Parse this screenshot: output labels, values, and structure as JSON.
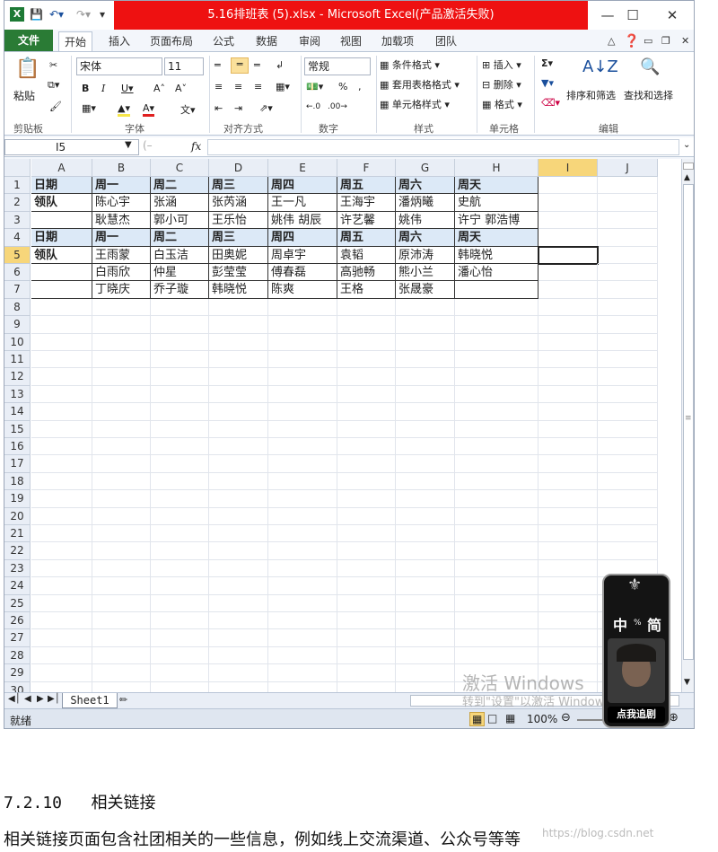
{
  "title": "5.16排班表 (5).xlsx - Microsoft Excel(产品激活失败)",
  "ribbon_tabs": [
    "文件",
    "开始",
    "插入",
    "页面布局",
    "公式",
    "数据",
    "审阅",
    "视图",
    "加载项",
    "团队"
  ],
  "ribbon": {
    "paste": "粘贴",
    "font_name": "宋体",
    "font_size": "11",
    "number_format": "常规",
    "conditional_format": "条件格式",
    "table_format": "套用表格格式",
    "cell_style": "单元格样式",
    "insert": "插入",
    "delete": "删除",
    "format": "格式",
    "sort_filter": "排序和筛选",
    "find_select": "查找和选择",
    "groups": [
      "剪贴板",
      "字体",
      "对齐方式",
      "数字",
      "样式",
      "单元格",
      "编辑"
    ]
  },
  "namebox": "I5",
  "formula_fx": "fx",
  "columns": [
    "A",
    "B",
    "C",
    "D",
    "E",
    "F",
    "G",
    "H",
    "I",
    "J"
  ],
  "rows": [
    "1",
    "2",
    "3",
    "4",
    "5",
    "6",
    "7",
    "8",
    "9",
    "10",
    "11",
    "12",
    "13",
    "14",
    "15",
    "16",
    "17",
    "18",
    "19",
    "20",
    "21",
    "22",
    "23",
    "24",
    "25",
    "26",
    "27",
    "28",
    "29",
    "30"
  ],
  "cells": {
    "r1": [
      "日期",
      "周一",
      "周二",
      "周三",
      "周四",
      "周五",
      "周六",
      "周天"
    ],
    "r2": [
      "领队",
      "陈心宇",
      "张涵",
      "张芮涵",
      "王一凡",
      "王海宇",
      "潘炳曦",
      "史航"
    ],
    "r3": [
      "",
      "耿慧杰",
      "郭小可",
      "王乐怡",
      "姚伟 胡辰",
      "许艺馨",
      "姚伟",
      "许宁 郭浩博"
    ],
    "r4": [
      "日期",
      "周一",
      "周二",
      "周三",
      "周四",
      "周五",
      "周六",
      "周天"
    ],
    "r5": [
      "领队",
      "王雨蒙",
      "白玉洁",
      "田奥妮",
      "周卓宇",
      "袁韬",
      "原沛涛",
      "韩晓悦"
    ],
    "r6": [
      "",
      "白雨欣",
      "仲星",
      "彭莹莹",
      "傅春磊",
      "高驰畅",
      "熊小兰",
      "潘心怡"
    ],
    "r7": [
      "",
      "丁晓庆",
      "乔子璇",
      "韩晓悦",
      "陈爽",
      "王格",
      "张晟豪",
      ""
    ]
  },
  "sheet_tab": "Sheet1",
  "status_ready": "就绪",
  "zoom": "100%",
  "watermark_line1": "激活 Windows",
  "watermark_line2": "转到\"设置\"以激活 Windows",
  "widget_text": "中",
  "widget_text2": "简",
  "widget_button": "点我追剧",
  "section_number": "7.2.10",
  "section_title": "相关链接",
  "paragraph": "相关链接页面包含社团相关的一些信息，例如线上交流渠道、公众号等等",
  "csdn_watermark": "https://blog.csdn.net"
}
